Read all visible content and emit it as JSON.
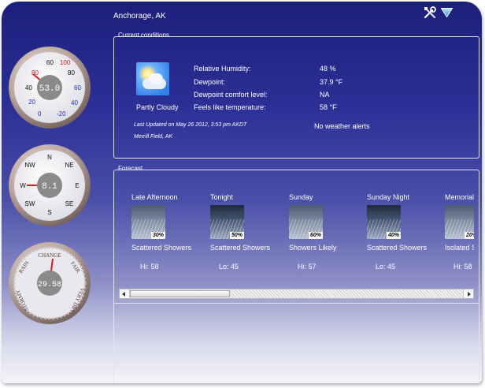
{
  "location": "Anchorage, AK",
  "icons": {
    "settings": "tools-icon",
    "menu": "dropdown-triangle-icon"
  },
  "colors": {
    "accent": "#2c3096",
    "panel_border": "#e2e4f4",
    "gauge_red": "#d8191f",
    "gauge_blue": "#1b2cc4"
  },
  "gauges": {
    "temperature": {
      "value": "53.0",
      "ticks": [
        {
          "label": "60",
          "color": "#111111"
        },
        {
          "label": "100",
          "color": "#d8191f"
        },
        {
          "label": "40",
          "color": "#111111"
        },
        {
          "label": "80",
          "color": "#d8191f"
        },
        {
          "label": "80",
          "color": "#111111"
        },
        {
          "label": "60",
          "color": "#1b2cc4"
        },
        {
          "label": "20",
          "color": "#1b2cc4"
        },
        {
          "label": "40",
          "color": "#1b2cc4"
        },
        {
          "label": "0",
          "color": "#1b2cc4"
        },
        {
          "label": "-20",
          "color": "#1b2cc4"
        }
      ]
    },
    "wind": {
      "value": "8.1",
      "directions": [
        "N",
        "NE",
        "E",
        "SE",
        "S",
        "SW",
        "W",
        "NW"
      ]
    },
    "pressure": {
      "value": "29.58",
      "labels": [
        "CHANGE",
        "FAIR",
        "VERY DRY",
        "STORMY",
        "RAIN"
      ]
    }
  },
  "current": {
    "panel_title": "Current conditions",
    "condition": "Partly Cloudy",
    "fields": [
      {
        "label": "Relative Humidity:",
        "value": "48 %"
      },
      {
        "label": "Dewpoint:",
        "value": "37.9 °F"
      },
      {
        "label": "Dewpoint comfort level:",
        "value": "NA"
      },
      {
        "label": "Feels like temperature:",
        "value": "58 °F"
      }
    ],
    "last_updated": "Last Updated on May 26 2012, 3:53 pm AKDT",
    "station": "Merrill Field, AK",
    "alerts": "No weather alerts"
  },
  "forecast": {
    "panel_title": "Forecast",
    "days": [
      {
        "name": "Late Afternoon",
        "pop": "30%",
        "desc": "Scattered Showers",
        "temp": "Hi:   58",
        "storm": false
      },
      {
        "name": "Tonight",
        "pop": "50%",
        "desc": "Scattered Showers",
        "temp": "Lo:   45",
        "storm": true
      },
      {
        "name": "Sunday",
        "pop": "60%",
        "desc": "Showers Likely",
        "temp": "Hi:   57",
        "storm": false
      },
      {
        "name": "Sunday Night",
        "pop": "40%",
        "desc": "Scattered Showers",
        "temp": "Lo:   45",
        "storm": true
      },
      {
        "name": "Memorial Day",
        "pop": "20%",
        "desc": "Isolated Showers",
        "temp": "Hi:   58",
        "storm": false
      }
    ]
  }
}
